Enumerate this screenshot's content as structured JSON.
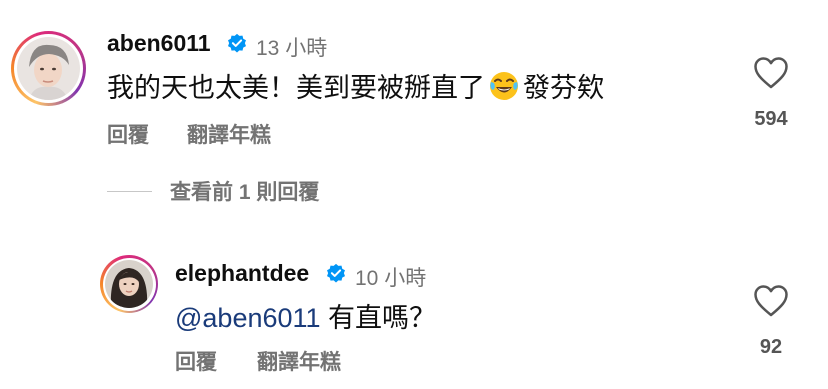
{
  "comment": {
    "username": "aben6011",
    "time": "13 小時",
    "text_before": "我的天也太美！美到要被掰直了",
    "text_after": "發芬欸",
    "reply_label": "回覆",
    "translate_label": "翻譯年糕",
    "like_count": "594",
    "emoji_icon": "face-with-tears-of-joy-icon"
  },
  "view_replies": {
    "label": "查看前 1 則回覆"
  },
  "reply": {
    "username": "elephantdee",
    "time": "10 小時",
    "mention": "@aben6011",
    "text": " 有直嗎？",
    "reply_label": "回覆",
    "translate_label": "翻譯年糕",
    "like_count": "92"
  },
  "colors": {
    "verified_badge": "#0095f6",
    "secondary_text": "#737373",
    "mention_text": "#1a3b7a"
  }
}
